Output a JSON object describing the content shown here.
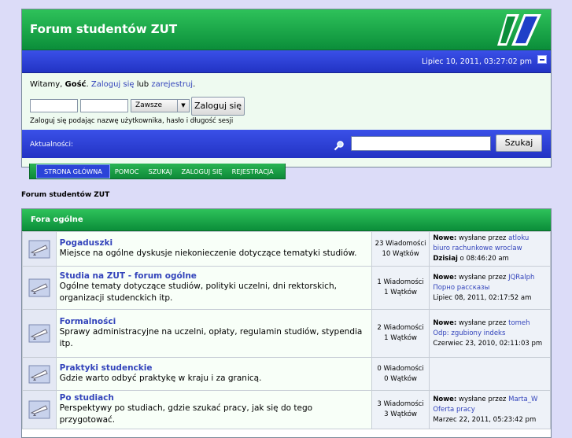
{
  "header": {
    "title": "Forum studentów ZUT",
    "date": "Lipiec 10, 2011, 03:27:02 pm"
  },
  "login": {
    "welcome_prefix": "Witamy, ",
    "guest": "Gość",
    "welcome_sep": ". ",
    "login_link": "Zaloguj się",
    "or": " lub ",
    "register_link": "zarejestruj",
    "period": ".",
    "duration_value": "Zawsze",
    "login_button": "Zaloguj się",
    "hint": "Zaloguj się podając nazwę użytkownika, hasło i długość sesji"
  },
  "news": {
    "label": "Aktualności:"
  },
  "search": {
    "button": "Szukaj"
  },
  "nav": [
    "STRONA GŁÓWNA",
    "POMOC",
    "SZUKAJ",
    "ZALOGUJ SIĘ",
    "REJESTRACJA"
  ],
  "breadcrumb": "Forum studentów ZUT",
  "category": "Fora ogólne",
  "boards": [
    {
      "name": "Pogaduszki",
      "desc": "Miejsce na ogólne dyskusje niekonieczenie dotyczące tematyki studiów.",
      "posts": "23 Wiadomości",
      "topics": "10 Wątków",
      "last_label": "Nowe:",
      "last_by": " wysłane przez ",
      "last_user": "atloku",
      "last_topic": "biuro rachunkowe wroclaw",
      "last_time_bold": "Dzisiaj",
      "last_time": " o 08:46:20 am"
    },
    {
      "name": "Studia na ZUT - forum ogólne",
      "desc": "Ogólne tematy dotyczące studiów, polityki uczelni, dni rektorskich, organizacji studenckich itp.",
      "posts": "1 Wiadomości",
      "topics": "1 Wątków",
      "last_label": "Nowe:",
      "last_by": " wysłane przez ",
      "last_user": "JQRalph",
      "last_topic": "Порно рассказы",
      "last_time_bold": "",
      "last_time": "Lipiec 08, 2011, 02:17:52 am"
    },
    {
      "name": "Formalności",
      "desc": "Sprawy administracyjne na uczelni, opłaty, regulamin studiów, stypendia itp.",
      "posts": "2 Wiadomości",
      "topics": "1 Wątków",
      "last_label": "Nowe:",
      "last_by": " wysłane przez ",
      "last_user": "tomeh",
      "last_topic": "Odp: zgubiony indeks",
      "last_time_bold": "",
      "last_time": "Czerwiec 23, 2010, 02:11:03 pm"
    },
    {
      "name": "Praktyki studenckie",
      "desc": "Gdzie warto odbyć praktykę w kraju i za granicą.",
      "posts": "0 Wiadomości",
      "topics": "0 Wątków",
      "last_label": "",
      "last_by": "",
      "last_user": "",
      "last_topic": "",
      "last_time_bold": "",
      "last_time": ""
    },
    {
      "name": "Po studiach",
      "desc": "Perspektywy po studiach, gdzie szukać pracy, jak się do tego przygotować.",
      "posts": "3 Wiadomości",
      "topics": "3 Wątków",
      "last_label": "Nowe:",
      "last_by": " wysłane przez ",
      "last_user": "Marta_W",
      "last_topic": "Oferta pracy",
      "last_time_bold": "",
      "last_time": "Marzec 22, 2011, 05:23:42 pm"
    }
  ],
  "colors": {
    "green": "#1aa646",
    "blue": "#2b3fd6",
    "link": "#3344bb"
  }
}
